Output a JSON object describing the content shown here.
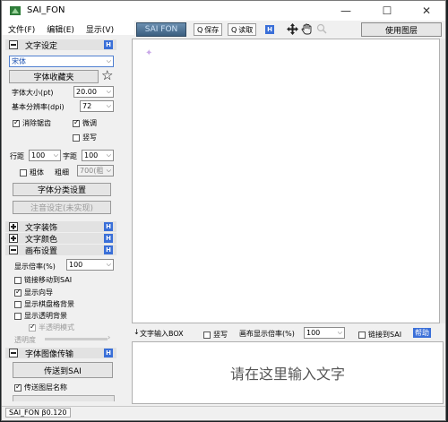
{
  "window": {
    "title": "SAI_FON",
    "controls": {
      "minimize": "—",
      "maximize": "☐",
      "close": "✕"
    }
  },
  "menu": [
    "文件(F)",
    "编辑(E)",
    "显示(V)"
  ],
  "toolbar": {
    "logo": "SAI FON",
    "save": "保存",
    "load": "读取",
    "use_layer": "使用图层",
    "badge": "H"
  },
  "panel": {
    "text_settings": {
      "header": "文字设定",
      "font": "宋体",
      "font_collection": "字体收藏夹",
      "font_size_label": "字体大小(pt)",
      "font_size": "20.00",
      "resolution_label": "基本分辨率(dpi)",
      "resolution": "72",
      "antialias": "消除锯齿",
      "fine_tune": "微调",
      "vertical": "竖写",
      "line_spacing_label": "行距",
      "line_spacing": "100",
      "char_spacing_label": "字距",
      "char_spacing": "100",
      "bold": "粗体",
      "weight_label": "粗细",
      "weight": "700(粗",
      "font_category": "字体分类设置",
      "note_settings": "注音设定(未实现)"
    },
    "text_decoration": {
      "header": "文字装饰"
    },
    "text_color": {
      "header": "文字颜色"
    },
    "canvas_settings": {
      "header": "画布设置",
      "zoom_label": "显示倍率(%)",
      "zoom": "100",
      "link_move": "链接移动到SAI",
      "show_guide": "显示向导",
      "show_checker": "显示棋盘格背景",
      "show_transparent": "显示透明背景",
      "semi_transparent": "半透明模式",
      "transparency_label": "透明度"
    },
    "transfer": {
      "header": "字体图像传输",
      "send_button": "传送到SAI",
      "send_layer_name": "传送图层名称"
    }
  },
  "input_bar": {
    "text_input": "文字输入BOX",
    "vertical": "竖写",
    "canvas_zoom_label": "画布显示倍率(%)",
    "canvas_zoom": "100",
    "link_to_sai": "链接到SAI",
    "help": "帮助"
  },
  "input_area": {
    "placeholder": "请在这里输入文字"
  },
  "status": {
    "version": "SAI_FON β0.120"
  },
  "colors": {
    "badge": "#3a6fd8",
    "logo_top": "#6b8fb0",
    "logo_bottom": "#3c5f80"
  }
}
